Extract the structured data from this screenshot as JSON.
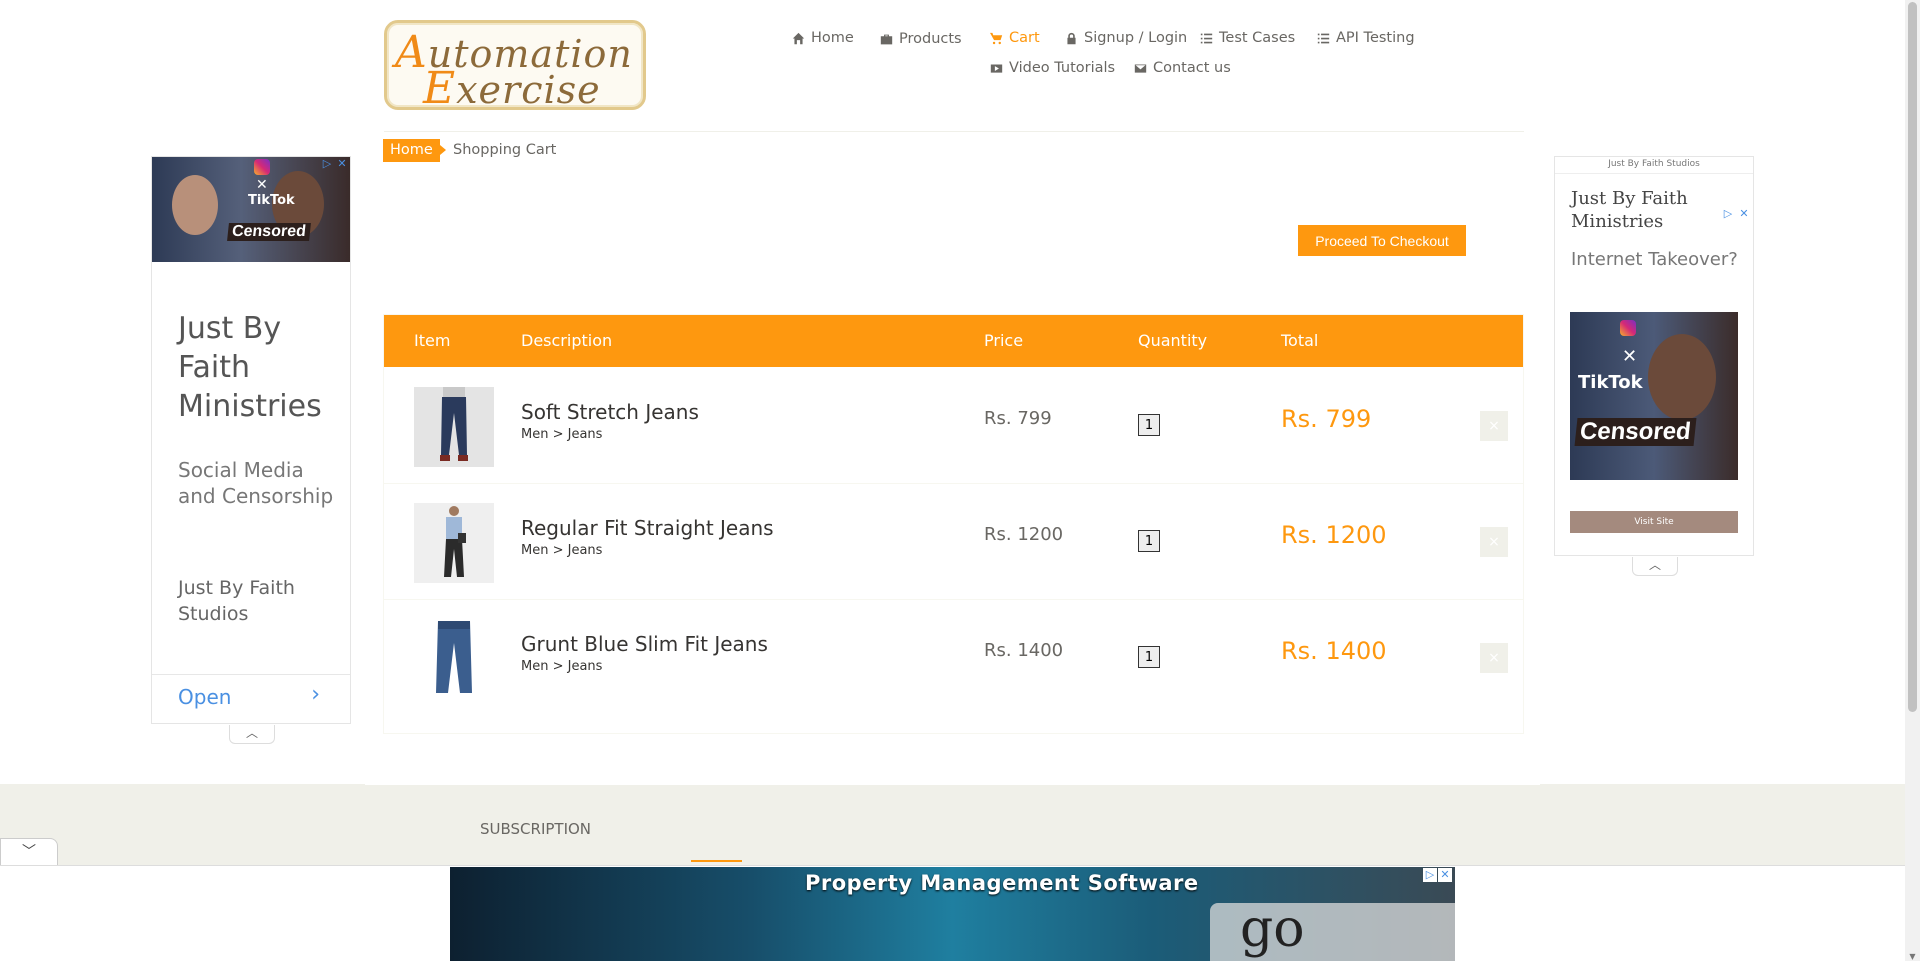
{
  "logo": {
    "line1": "utomation",
    "line1_cap": "A",
    "line2": "xercise",
    "line2_cap": "E"
  },
  "nav": {
    "home": "Home",
    "products": "Products",
    "cart": "Cart",
    "signup": "Signup / Login",
    "test_cases": "Test Cases",
    "api_testing": "API Testing",
    "video_tutorials": "Video Tutorials",
    "contact": "Contact us"
  },
  "breadcrumb": {
    "home": "Home",
    "current": "Shopping Cart"
  },
  "checkout_label": "Proceed To Checkout",
  "table": {
    "headers": {
      "item": "Item",
      "description": "Description",
      "price": "Price",
      "quantity": "Quantity",
      "total": "Total"
    },
    "rows": [
      {
        "name": "Soft Stretch Jeans",
        "category": "Men > Jeans",
        "price": "Rs. 799",
        "quantity": "1",
        "total": "Rs. 799"
      },
      {
        "name": "Regular Fit Straight Jeans",
        "category": "Men > Jeans",
        "price": "Rs. 1200",
        "quantity": "1",
        "total": "Rs. 1200"
      },
      {
        "name": "Grunt Blue Slim Fit Jeans",
        "category": "Men > Jeans",
        "price": "Rs. 1400",
        "quantity": "1",
        "total": "Rs. 1400"
      }
    ],
    "delete_glyph": "×"
  },
  "ad_left": {
    "headline": "Just By Faith Ministries",
    "sub": "Social Media and Censorship",
    "brand": "Just By Faith Studios",
    "open": "Open",
    "censored": "Censored",
    "tiktok": "TikTok"
  },
  "ad_right": {
    "brand": "Just By Faith Studios",
    "headline": "Just By Faith Ministries",
    "sub": "Internet Takeover?",
    "visit": "Visit Site",
    "censored": "Censored",
    "tiktok": "TikTok"
  },
  "footer": {
    "subscription": "SUBSCRIPTION"
  },
  "bottom_ad": {
    "title": "Property Management Software",
    "go": "go"
  },
  "colors": {
    "accent": "#fe980f",
    "text": "#696763",
    "footer_bg": "#f0f0e9"
  }
}
